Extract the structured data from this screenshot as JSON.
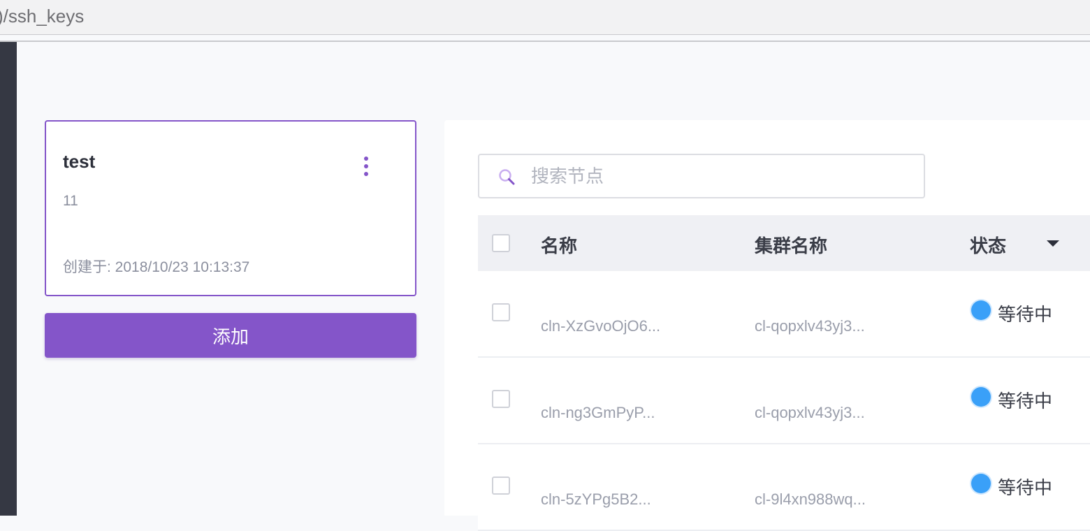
{
  "browser": {
    "url_fragment": ")/ssh_keys"
  },
  "key_card": {
    "name": "test",
    "description": "11",
    "created_label": "创建于: 2018/10/23 10:13:37"
  },
  "add_button_label": "添加",
  "search": {
    "placeholder": "搜索节点"
  },
  "table": {
    "columns": [
      "名称",
      "集群名称",
      "状态"
    ],
    "rows": [
      {
        "name": "cln-XzGvoOjO6...",
        "cluster": "cl-qopxlv43yj3...",
        "status": "等待中"
      },
      {
        "name": "cln-ng3GmPyP...",
        "cluster": "cl-qopxlv43yj3...",
        "status": "等待中"
      },
      {
        "name": "cln-5zYPg5B2...",
        "cluster": "cl-9l4xn988wq...",
        "status": "等待中"
      }
    ]
  },
  "colors": {
    "accent": "#8455c9",
    "status_pending": "#3aa0f8",
    "rail": "#353843"
  }
}
